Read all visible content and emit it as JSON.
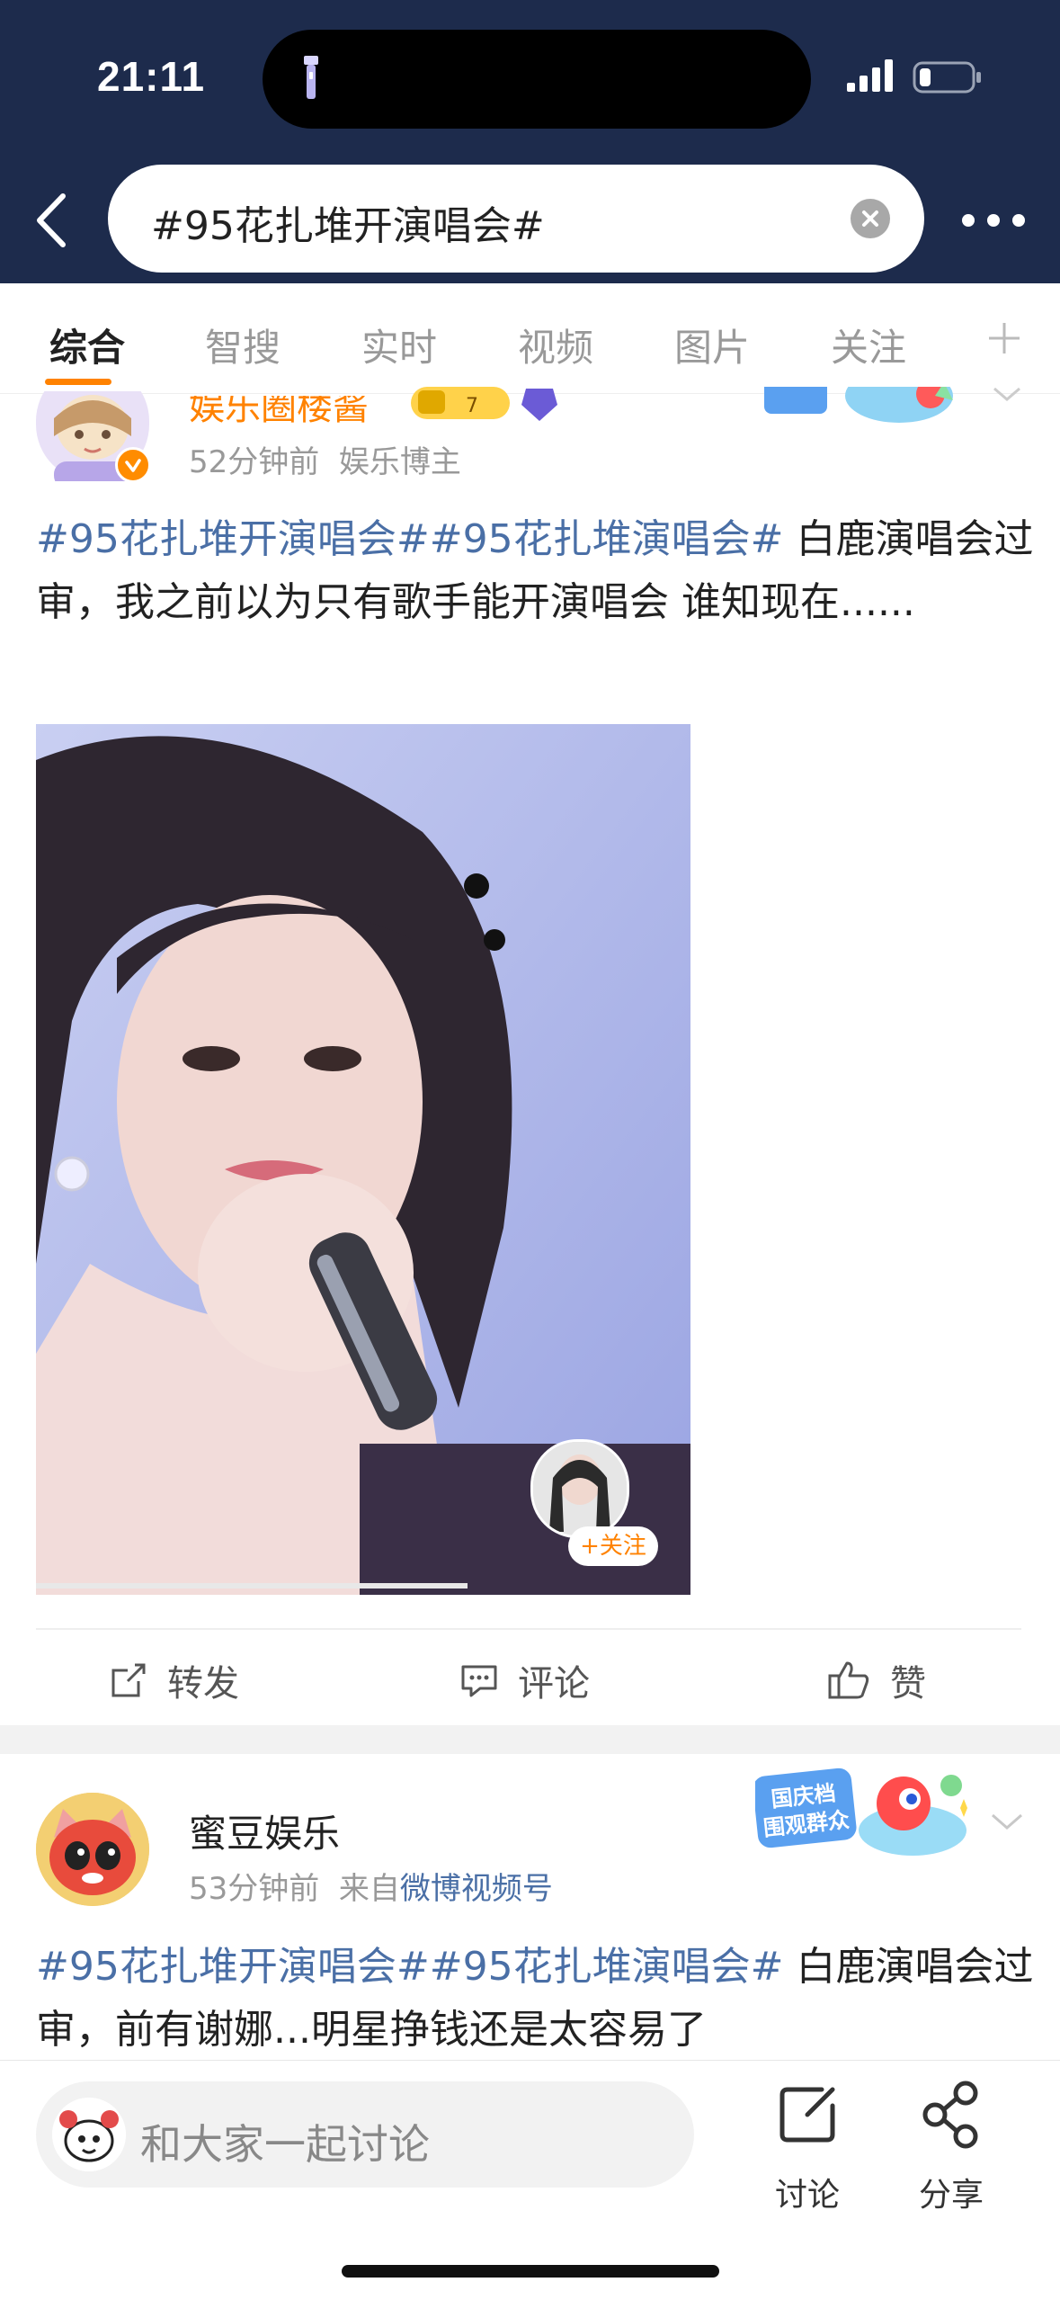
{
  "status_bar": {
    "time": "21:11"
  },
  "search": {
    "query": "#95花扎堆开演唱会#"
  },
  "tabs": [
    {
      "label": "综合"
    },
    {
      "label": "智搜"
    },
    {
      "label": "实时"
    },
    {
      "label": "视频"
    },
    {
      "label": "图片"
    },
    {
      "label": "关注"
    }
  ],
  "post1": {
    "author": "娱乐圈楼酱",
    "time": "52分钟前",
    "role": "娱乐博主",
    "topics": "#95花扎堆开演唱会##95花扎堆演唱会#",
    "text": " 白鹿演唱会过审，我之前以为只有歌手能开演唱会 谁知现在......",
    "follow_label": "+关注",
    "actions": {
      "repost": "转发",
      "comment": "评论",
      "like": "赞"
    }
  },
  "post2": {
    "author": "蜜豆娱乐",
    "time": "53分钟前",
    "source_prefix": "来自",
    "source": "微博视频号",
    "badge": "国庆档 围观群众",
    "topics": "#95花扎堆开演唱会##95花扎堆演唱会#",
    "text": " 白鹿演唱会过审，前有谢娜...明星挣钱还是太容易了"
  },
  "bottom_bar": {
    "comment_placeholder": "和大家一起讨论",
    "discuss_label": "讨论",
    "share_label": "分享"
  },
  "colors": {
    "header_bg": "#1d2b4c",
    "accent": "#ff8200",
    "topic": "#4a6fa6"
  }
}
